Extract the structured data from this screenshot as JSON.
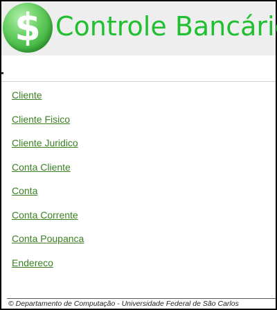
{
  "header": {
    "logo_icon": "dollar-sign-icon",
    "logo_glyph": "$",
    "title": "Controle Bancário",
    "colors": {
      "title": "#1fbf2f",
      "logo": "#3fb43f",
      "header_bg": "#eeeeee"
    }
  },
  "menu": {
    "items": [
      {
        "label": "Cliente"
      },
      {
        "label": "Cliente Fisico"
      },
      {
        "label": "Cliente Juridico"
      },
      {
        "label": "Conta Cliente"
      },
      {
        "label": "Conta"
      },
      {
        "label": "Conta Corrente"
      },
      {
        "label": "Conta Poupanca"
      },
      {
        "label": "Endereco"
      }
    ],
    "link_color": "#3a7f22"
  },
  "footer": {
    "text": "© Departamento de Computação - Universidade Federal de São Carlos"
  }
}
